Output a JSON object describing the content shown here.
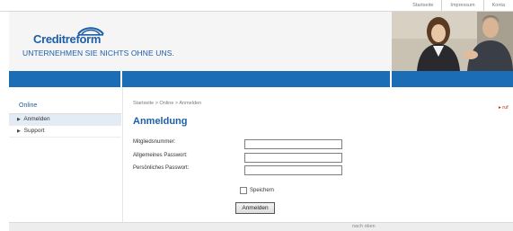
{
  "top_nav": {
    "links": [
      "Startseite",
      "Impressum",
      "Konta"
    ]
  },
  "header": {
    "logo_text": "Creditreform",
    "slogan": "UNTERNEHMEN SIE NICHTS OHNE UNS."
  },
  "sidebar": {
    "title": "Online",
    "items": [
      {
        "label": "Anmelden",
        "active": true
      },
      {
        "label": "Support",
        "active": false
      }
    ]
  },
  "main": {
    "breadcrumb": "Startseite > Online > Anmelden",
    "title": "Anmeldung",
    "right_link": "▸ ruf"
  },
  "form": {
    "fields": [
      {
        "label": "Mitgliedsnummer:",
        "value": ""
      },
      {
        "label": "Allgemeines Passwort:",
        "value": ""
      },
      {
        "label": "Persönliches Passwort:",
        "value": ""
      }
    ],
    "remember_label": "Speichern",
    "remember_checked": false,
    "submit_label": "Anmelden"
  },
  "footer": {
    "link": "nach oben"
  },
  "colors": {
    "brand_blue": "#1e5ea8",
    "bar_blue": "#1b6db5",
    "accent_red": "#c0261c"
  },
  "icons": {
    "logo_mark": "creditreform-logo-icon",
    "bullet": "triangle-right-icon"
  }
}
